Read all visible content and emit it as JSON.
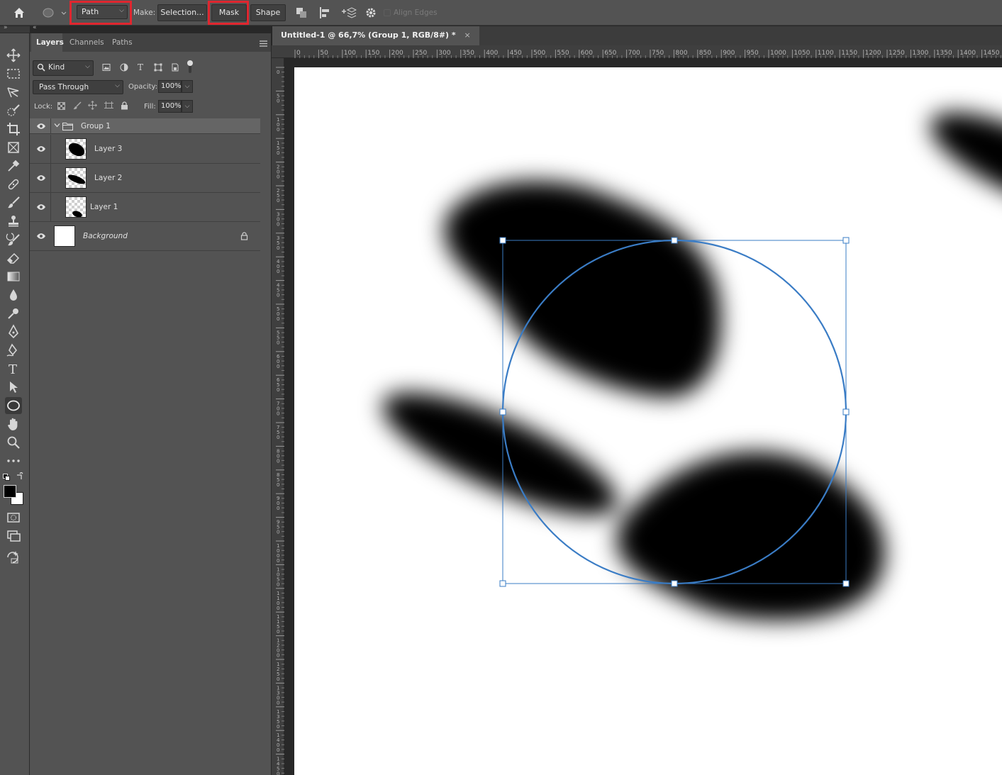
{
  "options_bar": {
    "tool_mode": "Path",
    "make_label": "Make:",
    "selection_button": "Selection...",
    "mask_button": "Mask",
    "shape_button": "Shape",
    "align_edges_label": "Align Edges",
    "highlight_color": "#e0262f"
  },
  "panel": {
    "tabs": [
      "Layers",
      "Channels",
      "Paths"
    ],
    "active_tab": "Layers",
    "filter_kind": "Kind",
    "blend_mode": "Pass Through",
    "opacity_label": "Opacity:",
    "opacity_value": "100%",
    "lock_label": "Lock:",
    "fill_label": "Fill:",
    "fill_value": "100%",
    "layers": [
      {
        "name": "Group 1",
        "type": "group",
        "visible": true,
        "selected": true,
        "expanded": true
      },
      {
        "name": "Layer 3",
        "type": "pixel",
        "visible": true
      },
      {
        "name": "Layer 2",
        "type": "pixel",
        "visible": true
      },
      {
        "name": "Layer 1",
        "type": "pixel",
        "visible": true
      },
      {
        "name": "Background",
        "type": "background",
        "visible": true,
        "locked": true
      }
    ]
  },
  "document": {
    "tab_title": "Untitled-1 @ 66,7% (Group 1, RGB/8#) *",
    "close_glyph": "×",
    "ruler_ticks": [
      "0",
      "50",
      "100",
      "150",
      "200",
      "250",
      "300",
      "350",
      "400",
      "450",
      "500",
      "550",
      "600",
      "650",
      "700",
      "750",
      "800",
      "850",
      "900",
      "950",
      "1000",
      "1050",
      "1100",
      "1150",
      "1200",
      "1250",
      "1300",
      "1350",
      "1400",
      "1450"
    ],
    "path_color": "#3a7cc5"
  }
}
